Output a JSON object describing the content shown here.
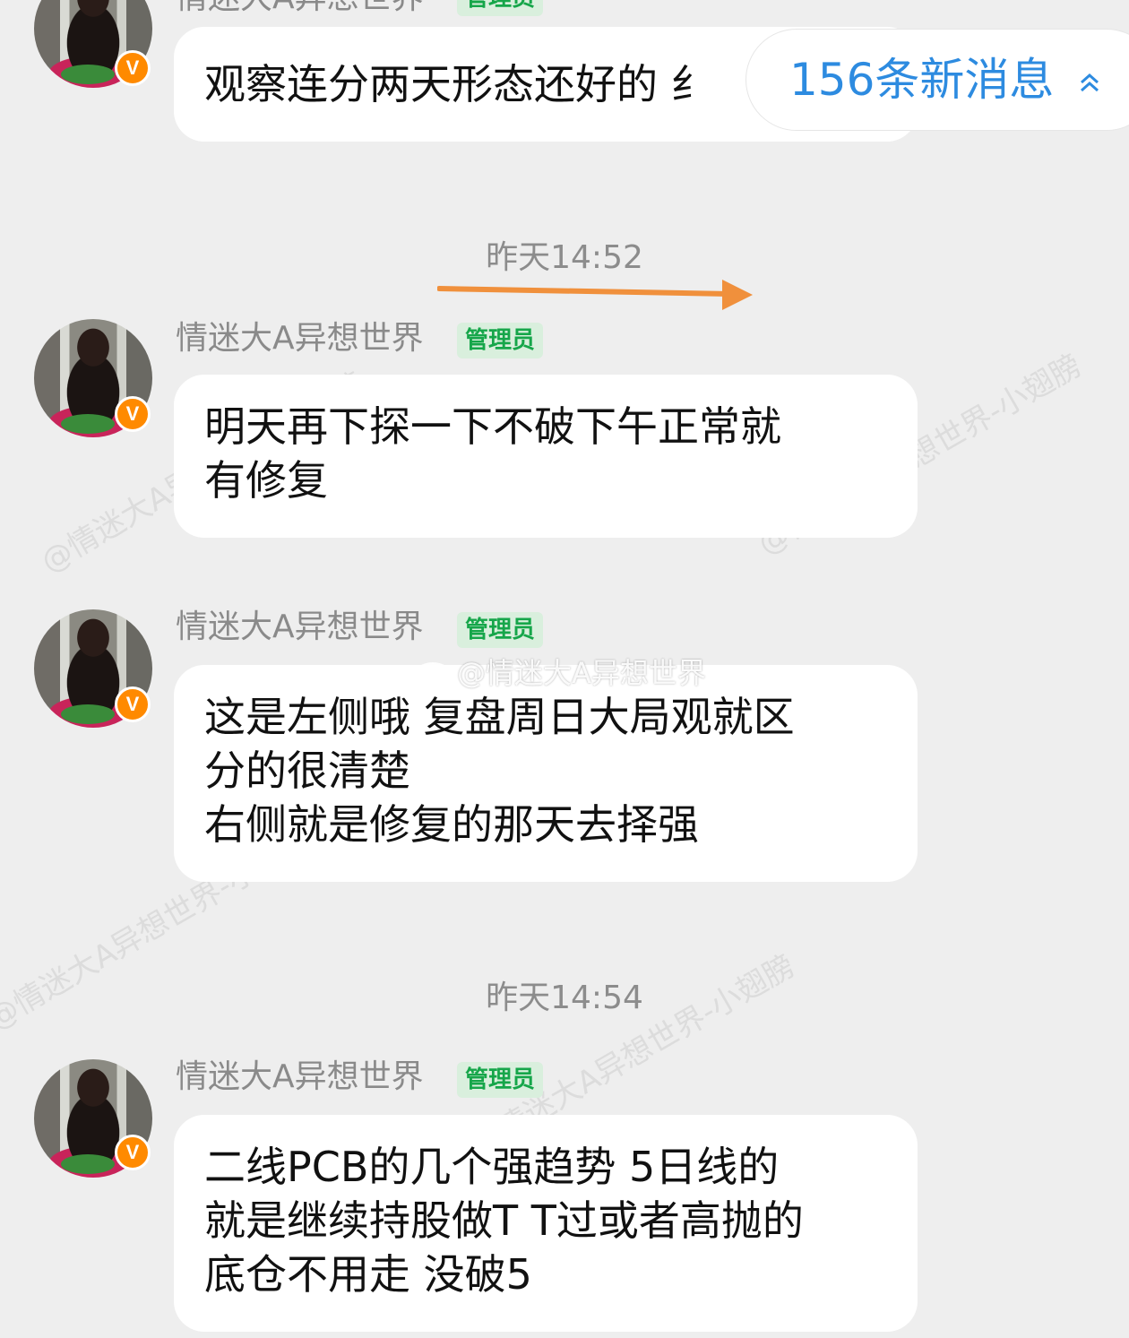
{
  "new_messages": {
    "label": "156条新消息"
  },
  "timestamps": [
    "昨天14:52",
    "昨天14:54"
  ],
  "watermarks": [
    "@情迷大A异想世界-小翅膀",
    "@情迷大A异想世界-小翅膀",
    "@情迷大A异想世界-小翅膀",
    "@情迷大A异想世界-小翅膀"
  ],
  "weibo_mark": "@情迷大A异想世界",
  "annotation_arrow_color": "#f0903c",
  "messages": [
    {
      "sender": "情迷大A异想世界",
      "role": "管理员",
      "verified_badge": "V",
      "text": "观察连分两天形态还好的 纟"
    },
    {
      "sender": "情迷大A异想世界",
      "role": "管理员",
      "verified_badge": "V",
      "text": "明天再下探一下不破下午正常就\n有修复"
    },
    {
      "sender": "情迷大A异想世界",
      "role": "管理员",
      "verified_badge": "V",
      "text": "这是左侧哦 复盘周日大局观就区\n分的很清楚\n右侧就是修复的那天去择强"
    },
    {
      "sender": "情迷大A异想世界",
      "role": "管理员",
      "verified_badge": "V",
      "text": "二线PCB的几个强趋势 5日线的\n就是继续持股做T T过或者高抛的\n底仓不用走 没破5"
    }
  ]
}
